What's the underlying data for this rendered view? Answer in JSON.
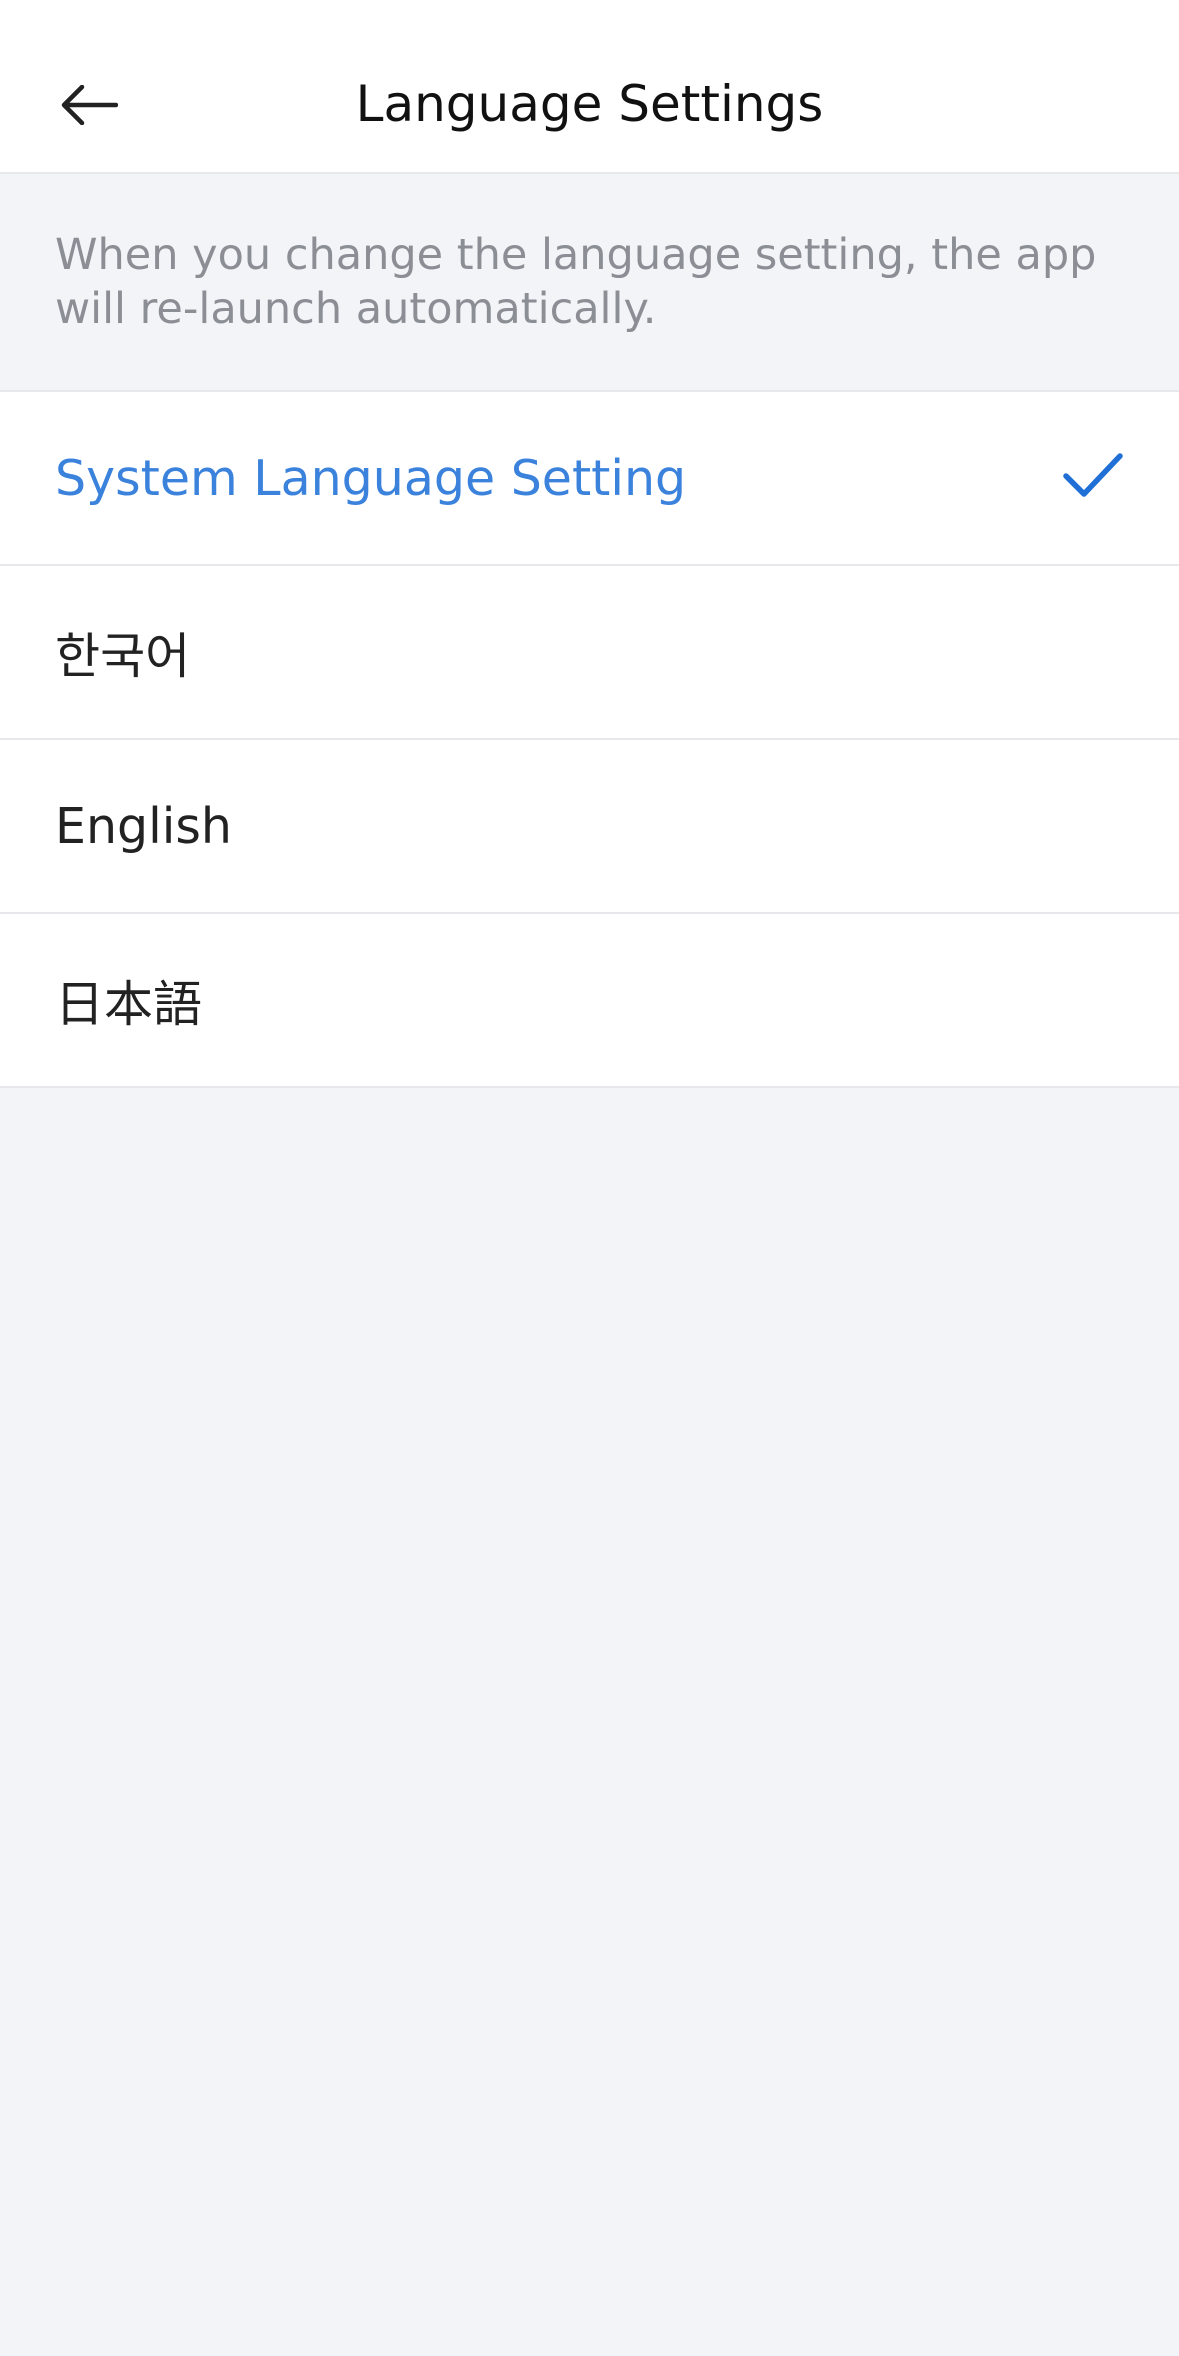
{
  "header": {
    "title": "Language Settings",
    "back_icon": "arrow-left-icon"
  },
  "notice": {
    "text": "When you change the language setting, the app will re-launch automatically."
  },
  "options": [
    {
      "label": "System Language Setting",
      "selected": true
    },
    {
      "label": "한국어",
      "selected": false
    },
    {
      "label": "English",
      "selected": false
    },
    {
      "label": "日本語",
      "selected": false
    }
  ],
  "colors": {
    "accent": "#3a82dc",
    "check": "#1f6fd6",
    "text": "#222222",
    "muted": "#8b8e94",
    "background": "#f3f4f7"
  },
  "icons": {
    "selected": "checkmark-icon"
  }
}
